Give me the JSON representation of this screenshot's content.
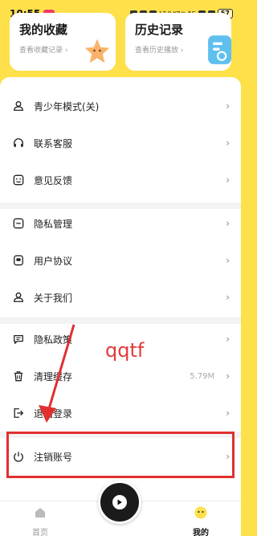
{
  "status_bar": {
    "time": "10:55",
    "network": "17.9 KB/s",
    "signal": "5G",
    "battery": "57"
  },
  "cards": {
    "favorites": {
      "title": "我的收藏",
      "subtitle": "查看收藏记录 ›"
    },
    "history": {
      "title": "历史记录",
      "subtitle": "查看历史播放 ›"
    }
  },
  "menu": {
    "youth_mode": {
      "label": "青少年模式(关)",
      "icon": "user-icon"
    },
    "customer_service": {
      "label": "联系客服",
      "icon": "headset-icon"
    },
    "feedback": {
      "label": "意见反馈",
      "icon": "feedback-icon"
    },
    "privacy_manage": {
      "label": "隐私管理",
      "icon": "minus-square-icon"
    },
    "user_agreement": {
      "label": "用户协议",
      "icon": "document-icon"
    },
    "about_us": {
      "label": "关于我们",
      "icon": "user-icon"
    },
    "privacy_policy": {
      "label": "隐私政策",
      "icon": "chat-icon"
    },
    "clear_cache": {
      "label": "清理缓存",
      "value": "5.79M",
      "icon": "trash-icon"
    },
    "logout": {
      "label": "退出登录",
      "icon": "logout-icon"
    },
    "cancel_account": {
      "label": "注销账号",
      "icon": "power-icon"
    },
    "chevron": "›"
  },
  "annotation": {
    "text": "qqtf",
    "color": "#e23a3a"
  },
  "bottom_nav": {
    "home": "首页",
    "mine": "我的"
  },
  "colors": {
    "accent": "#fde04a",
    "annotation_red": "#e03030"
  }
}
